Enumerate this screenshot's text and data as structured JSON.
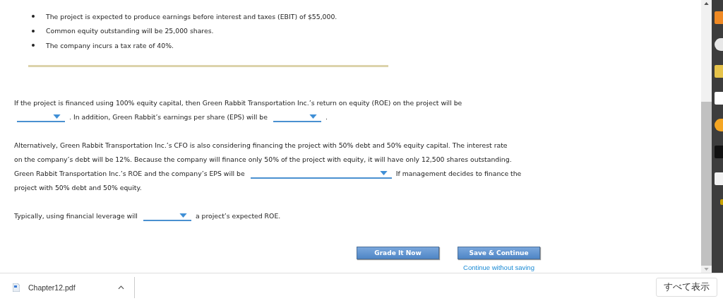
{
  "bullets": [
    "The project is expected to produce earnings before interest and taxes (EBIT) of $55,000.",
    "Common equity outstanding will be 25,000 shares.",
    "The company incurs a tax rate of 40%."
  ],
  "paragraphs": [
    [
      {
        "kind": "text",
        "text": "If the project is financed using 100% equity capital, then Green Rabbit Transportation Inc.’s return on equity (ROE) on the project will be"
      },
      {
        "kind": "break"
      },
      {
        "kind": "dropdown"
      },
      {
        "kind": "text",
        "text": ". In addition, Green Rabbit’s earnings per share (EPS) will be"
      },
      {
        "kind": "dropdown"
      },
      {
        "kind": "text",
        "text": "."
      }
    ],
    [
      {
        "kind": "text",
        "text": "Alternatively, Green Rabbit Transportation Inc.’s CFO is also considering financing the project with 50% debt and 50% equity capital. The interest rate"
      },
      {
        "kind": "break"
      },
      {
        "kind": "text",
        "text": "on the company’s debt will be 12%. Because the company will finance only 50% of the project with equity, it will have only 12,500 shares outstanding."
      },
      {
        "kind": "break"
      },
      {
        "kind": "text",
        "text": "Green Rabbit Transportation Inc.’s ROE and the company’s EPS will be"
      },
      {
        "kind": "widedropdown"
      },
      {
        "kind": "text",
        "text": "If management decides to finance the"
      },
      {
        "kind": "break"
      },
      {
        "kind": "text",
        "text": "project with 50% debt and 50% equity."
      }
    ],
    [
      {
        "kind": "text",
        "text": "Typically, using financial leverage will"
      },
      {
        "kind": "dropdown"
      },
      {
        "kind": "text",
        "text": "a project’s expected ROE."
      }
    ]
  ],
  "buttons": [
    "Grade It Now",
    "Save & Continue"
  ],
  "link": "Continue without saving",
  "download_bar": {
    "file": "Chapter12.pdf",
    "show_all": "すべて表示"
  }
}
